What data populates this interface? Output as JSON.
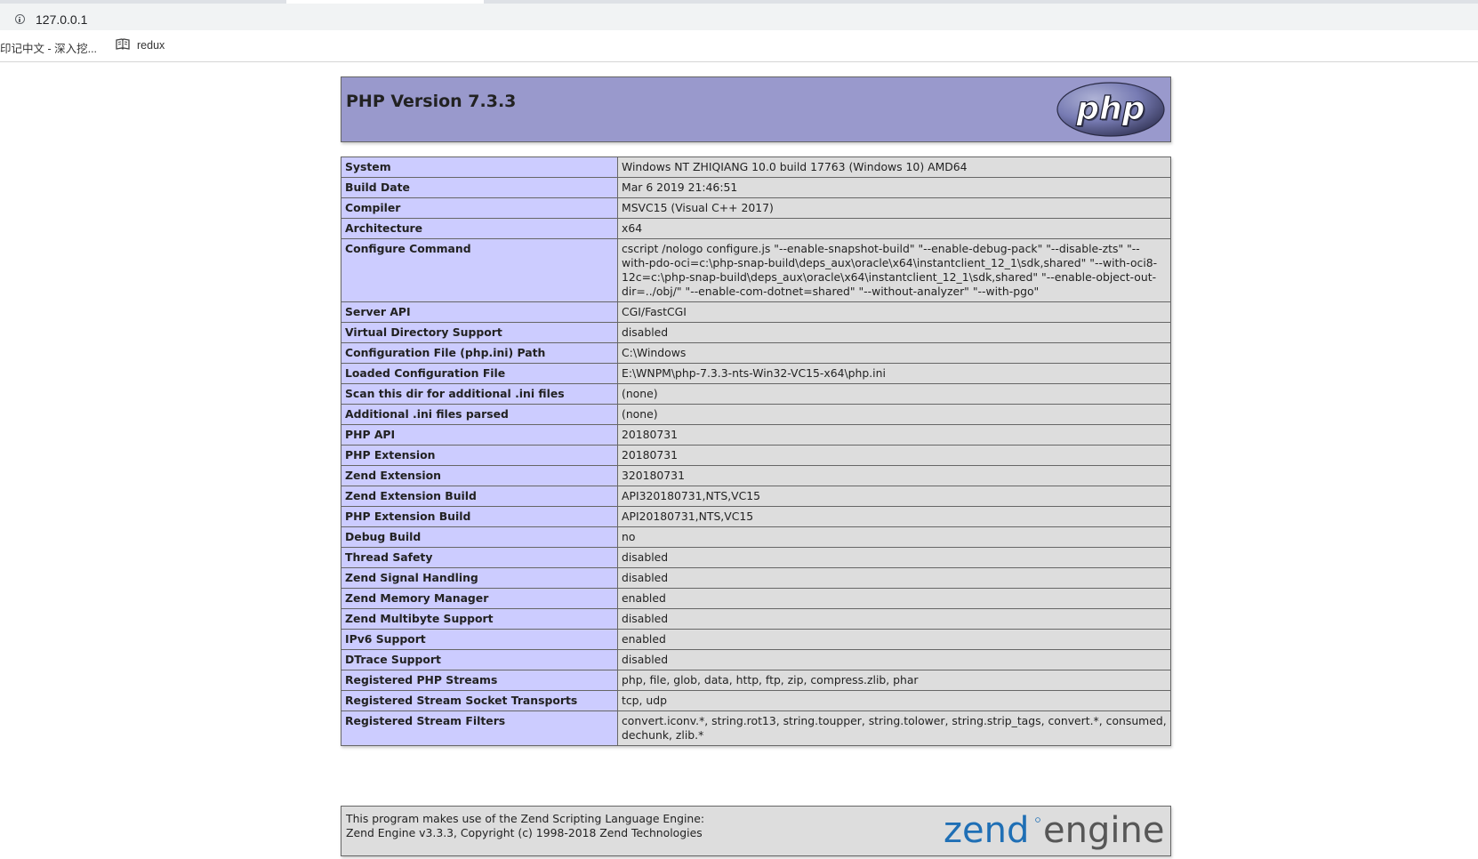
{
  "browser": {
    "url": "127.0.0.1",
    "bookmarks": [
      {
        "label": "印记中文 - 深入挖..."
      },
      {
        "label": "redux"
      }
    ]
  },
  "header": {
    "title": "PHP Version 7.3.3",
    "logo_text": "php"
  },
  "rows": [
    {
      "key": "System",
      "value": "Windows NT ZHIQIANG 10.0 build 17763 (Windows 10) AMD64"
    },
    {
      "key": "Build Date",
      "value": "Mar 6 2019 21:46:51"
    },
    {
      "key": "Compiler",
      "value": "MSVC15 (Visual C++ 2017)"
    },
    {
      "key": "Architecture",
      "value": "x64"
    },
    {
      "key": "Configure Command",
      "value": "cscript /nologo configure.js \"--enable-snapshot-build\" \"--enable-debug-pack\" \"--disable-zts\" \"--with-pdo-oci=c:\\php-snap-build\\deps_aux\\oracle\\x64\\instantclient_12_1\\sdk,shared\" \"--with-oci8-12c=c:\\php-snap-build\\deps_aux\\oracle\\x64\\instantclient_12_1\\sdk,shared\" \"--enable-object-out-dir=../obj/\" \"--enable-com-dotnet=shared\" \"--without-analyzer\" \"--with-pgo\""
    },
    {
      "key": "Server API",
      "value": "CGI/FastCGI"
    },
    {
      "key": "Virtual Directory Support",
      "value": "disabled"
    },
    {
      "key": "Configuration File (php.ini) Path",
      "value": "C:\\Windows"
    },
    {
      "key": "Loaded Configuration File",
      "value": "E:\\WNPM\\php-7.3.3-nts-Win32-VC15-x64\\php.ini"
    },
    {
      "key": "Scan this dir for additional .ini files",
      "value": "(none)"
    },
    {
      "key": "Additional .ini files parsed",
      "value": "(none)"
    },
    {
      "key": "PHP API",
      "value": "20180731"
    },
    {
      "key": "PHP Extension",
      "value": "20180731"
    },
    {
      "key": "Zend Extension",
      "value": "320180731"
    },
    {
      "key": "Zend Extension Build",
      "value": "API320180731,NTS,VC15"
    },
    {
      "key": "PHP Extension Build",
      "value": "API20180731,NTS,VC15"
    },
    {
      "key": "Debug Build",
      "value": "no"
    },
    {
      "key": "Thread Safety",
      "value": "disabled"
    },
    {
      "key": "Zend Signal Handling",
      "value": "disabled"
    },
    {
      "key": "Zend Memory Manager",
      "value": "enabled"
    },
    {
      "key": "Zend Multibyte Support",
      "value": "disabled"
    },
    {
      "key": "IPv6 Support",
      "value": "enabled"
    },
    {
      "key": "DTrace Support",
      "value": "disabled"
    },
    {
      "key": "Registered PHP Streams",
      "value": "php, file, glob, data, http, ftp, zip, compress.zlib, phar"
    },
    {
      "key": "Registered Stream Socket Transports",
      "value": "tcp, udp"
    },
    {
      "key": "Registered Stream Filters",
      "value": "convert.iconv.*, string.rot13, string.toupper, string.tolower, string.strip_tags, convert.*, consumed, dechunk, zlib.*"
    }
  ],
  "footer": {
    "line1": "This program makes use of the Zend Scripting Language Engine:",
    "line2": "Zend Engine v3.3.3, Copyright (c) 1998-2018 Zend Technologies",
    "logo_text_left": "zend",
    "logo_text_right": "engine"
  },
  "colors": {
    "header_bg": "#9999cc",
    "key_bg": "#ccccff",
    "value_bg": "#dddddd",
    "zend_blue": "#1f6fb5",
    "zend_gray": "#575757"
  }
}
